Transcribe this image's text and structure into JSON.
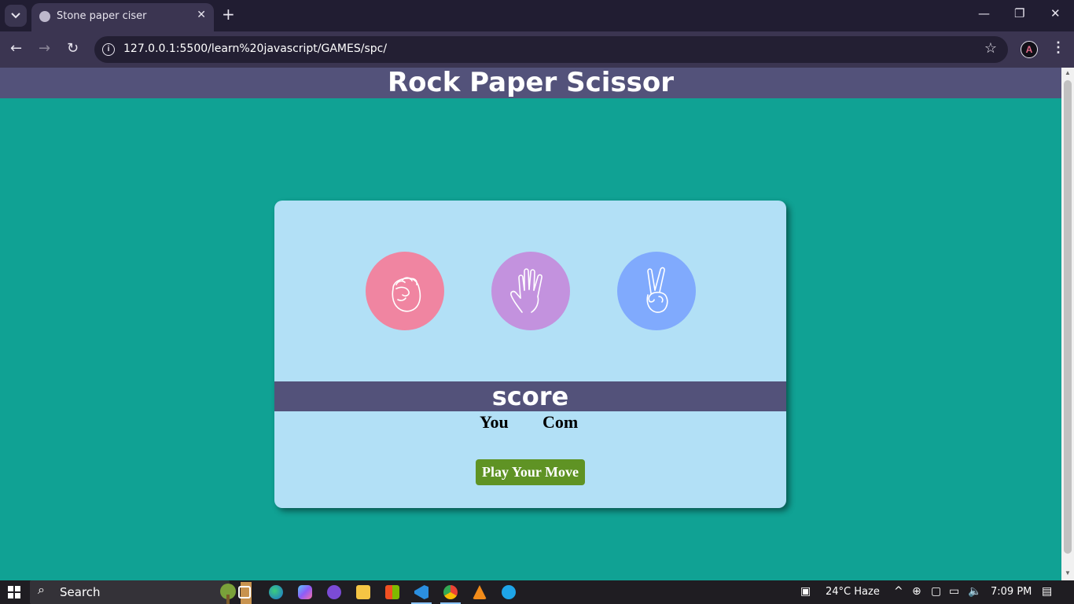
{
  "browser": {
    "tab_title": "Stone paper ciser",
    "url": "127.0.0.1:5500/learn%20javascript/GAMES/spc/",
    "tab_close_glyph": "✕",
    "new_tab_glyph": "+",
    "icons": [
      "tab-list-icon",
      "globe-icon",
      "close-icon",
      "plus-icon",
      "minimize-icon",
      "restore-icon",
      "window-close-icon",
      "back-icon",
      "forward-icon",
      "reload-icon",
      "info-icon",
      "star-icon",
      "profile-icon",
      "menu-icon"
    ]
  },
  "page": {
    "title": "Rock Paper Scissor"
  },
  "game": {
    "choices": [
      {
        "name": "rock",
        "color": "#f085a1",
        "icon": "fist-icon"
      },
      {
        "name": "paper",
        "color": "#c392de",
        "icon": "open-hand-icon"
      },
      {
        "name": "scissors",
        "color": "#80aafd",
        "icon": "peace-hand-icon"
      }
    ],
    "score_title": "score",
    "you_label": "You",
    "com_label": "Com",
    "play_button": "Play Your Move",
    "card_bg": "#b2e0f6",
    "header_bg": "#53527a",
    "button_bg": "#5f9324"
  },
  "colors": {
    "page_bg": "#10a294",
    "chrome_dark": "#211d32",
    "chrome_mid": "#3b3551"
  },
  "taskbar": {
    "search_label": "Search",
    "weather": "24°C  Haze",
    "time": "7:09 PM",
    "apps": [
      "task-view-icon",
      "edge-icon",
      "copilot-icon",
      "github-icon",
      "file-explorer-icon",
      "store-icon",
      "vscode-icon",
      "chrome-icon",
      "vlc-icon",
      "skype-icon"
    ]
  }
}
